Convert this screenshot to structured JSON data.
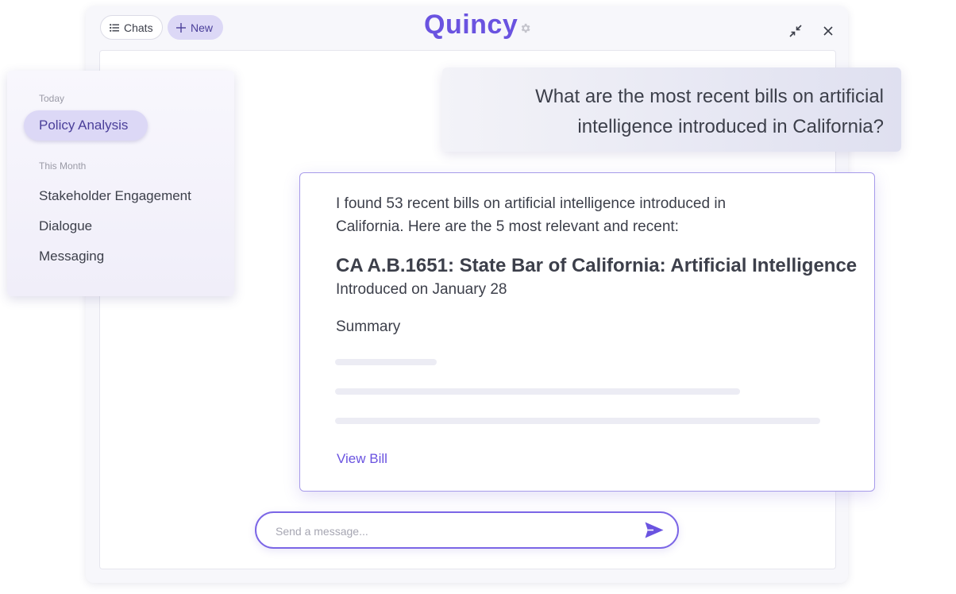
{
  "header": {
    "chats_label": "Chats",
    "new_label": "New",
    "brand": "Quincy",
    "icons": {
      "chats": "list-icon",
      "new": "plus-icon",
      "settings": "gear-icon",
      "minimize": "minimize-icon",
      "close": "close-icon"
    }
  },
  "sidebar": {
    "sections": [
      {
        "label": "Today",
        "items": [
          "Policy Analysis"
        ]
      },
      {
        "label": "This Month",
        "items": [
          "Stakeholder Engagement",
          "Dialogue",
          "Messaging"
        ]
      }
    ]
  },
  "conversation": {
    "user_message": "What are the most recent bills on artificial intelligence introduced in California?",
    "response": {
      "intro": "I found 53 recent bills on artificial intelligence introduced in California. Here are the 5 most relevant and recent:",
      "bill_title": "CA A.B.1651: State Bar of California: Artificial Intelligence",
      "bill_date": "Introduced on January 28",
      "summary_label": "Summary",
      "view_bill_label": "View Bill"
    }
  },
  "composer": {
    "placeholder": "Send a message...",
    "value": "",
    "send_icon": "send-icon"
  },
  "colors": {
    "accent": "#6a53e0",
    "active_pill": "#dcd8f6",
    "text": "#3c3f4a",
    "muted": "#9a9aa6"
  }
}
